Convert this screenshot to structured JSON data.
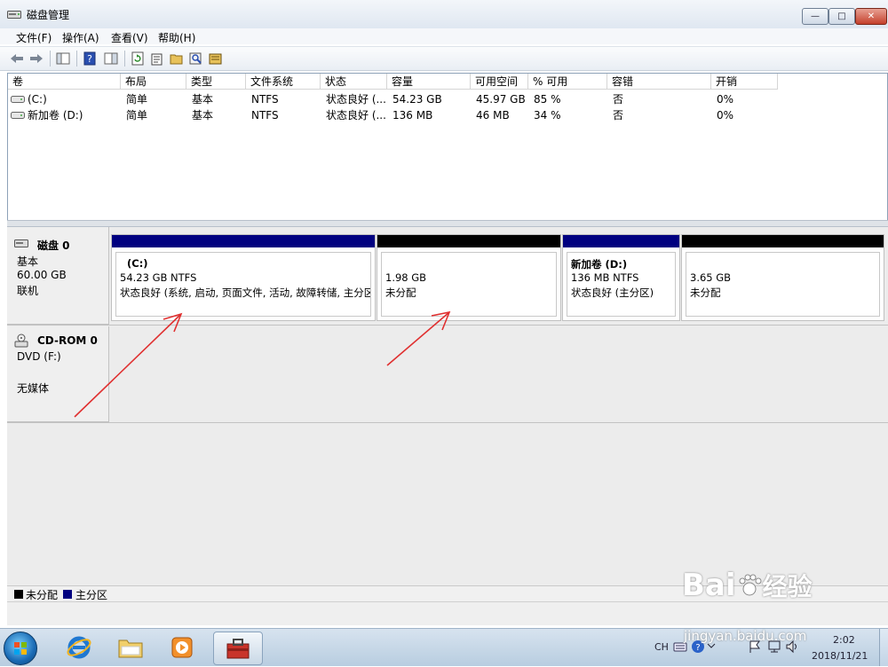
{
  "window": {
    "title": "磁盘管理",
    "min_glyph": "—",
    "max_glyph": "□",
    "close_glyph": "✕"
  },
  "menu": [
    "文件(F)",
    "操作(A)",
    "查看(V)",
    "帮助(H)"
  ],
  "volume_table": {
    "columns": [
      "卷",
      "布局",
      "类型",
      "文件系统",
      "状态",
      "容量",
      "可用空间",
      "% 可用",
      "容错",
      "开销"
    ],
    "rows": [
      [
        "(C:)",
        "简单",
        "基本",
        "NTFS",
        "状态良好 (...",
        "54.23 GB",
        "45.97 GB",
        "85 %",
        "否",
        "0%"
      ],
      [
        "新加卷 (D:)",
        "简单",
        "基本",
        "NTFS",
        "状态良好 (...",
        "136 MB",
        "46 MB",
        "34 %",
        "否",
        "0%"
      ]
    ]
  },
  "disks": [
    {
      "name": "磁盘 0",
      "type": "基本",
      "size": "60.00 GB",
      "status": "联机",
      "partitions": [
        {
          "label": "(C:)",
          "size": "54.23 GB NTFS",
          "status": "状态良好 (系统, 启动, 页面文件, 活动, 故障转储, 主分区)",
          "bar_color": "#000080"
        },
        {
          "label": "",
          "size": "1.98 GB",
          "status": "未分配",
          "bar_color": "#000000"
        },
        {
          "label": "新加卷  (D:)",
          "size": "136 MB NTFS",
          "status": "状态良好 (主分区)",
          "bar_color": "#000080"
        },
        {
          "label": "",
          "size": "3.65 GB",
          "status": "未分配",
          "bar_color": "#000000"
        }
      ]
    },
    {
      "name": "CD-ROM 0",
      "type": "DVD (F:)",
      "media": "无媒体"
    }
  ],
  "legend": [
    {
      "label": "未分配",
      "color": "#000000"
    },
    {
      "label": "主分区",
      "color": "#000080"
    }
  ],
  "colors": {
    "primary_partition": "#000080",
    "unallocated": "#000000",
    "annotation_arrow": "#e03030"
  },
  "taskbar": {
    "lang": "CH",
    "time": "2:02",
    "date": "2018/11/21"
  },
  "watermark": {
    "brand": "Bai",
    "brand_cn": "经验",
    "url": "jingyan.baidu.com"
  }
}
